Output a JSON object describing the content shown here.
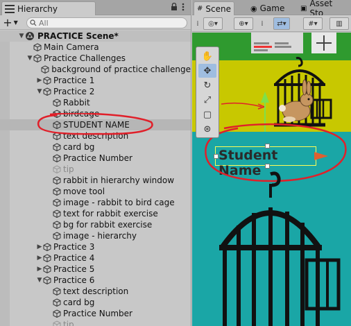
{
  "hierarchy": {
    "tab_label": "Hierarchy",
    "menu_icon": "kebab-icon",
    "lock_icon": "lock-icon",
    "add_label": "+",
    "search_placeholder": "All",
    "scene_name": "PRACTICE Scene*",
    "items": [
      {
        "label": "Main Camera",
        "depth": 1,
        "arrow": "",
        "dim": false
      },
      {
        "label": "Practice Challenges",
        "depth": 1,
        "arrow": "▼",
        "dim": false
      },
      {
        "label": "background of practice challenge",
        "depth": 2,
        "arrow": "",
        "dim": false
      },
      {
        "label": "Practice 1",
        "depth": 2,
        "arrow": "▶",
        "dim": false
      },
      {
        "label": "Practice 2",
        "depth": 2,
        "arrow": "▼",
        "dim": false
      },
      {
        "label": "Rabbit",
        "depth": 3,
        "arrow": "",
        "dim": false
      },
      {
        "label": "birdcage",
        "depth": 3,
        "arrow": "",
        "dim": false
      },
      {
        "label": "STUDENT NAME",
        "depth": 3,
        "arrow": "",
        "dim": false
      },
      {
        "label": "text description",
        "depth": 3,
        "arrow": "",
        "dim": false
      },
      {
        "label": "card bg",
        "depth": 3,
        "arrow": "",
        "dim": false
      },
      {
        "label": "Practice Number",
        "depth": 3,
        "arrow": "",
        "dim": false
      },
      {
        "label": "tip",
        "depth": 3,
        "arrow": "",
        "dim": true
      },
      {
        "label": "rabbit in hierarchy window",
        "depth": 3,
        "arrow": "",
        "dim": false
      },
      {
        "label": "move tool",
        "depth": 3,
        "arrow": "",
        "dim": false
      },
      {
        "label": "image - rabbit to bird cage",
        "depth": 3,
        "arrow": "",
        "dim": false
      },
      {
        "label": "text for rabbit exercise",
        "depth": 3,
        "arrow": "",
        "dim": false
      },
      {
        "label": "bg for rabbit exercise",
        "depth": 3,
        "arrow": "",
        "dim": false
      },
      {
        "label": "image - hierarchy",
        "depth": 3,
        "arrow": "",
        "dim": false
      },
      {
        "label": "Practice 3",
        "depth": 2,
        "arrow": "▶",
        "dim": false
      },
      {
        "label": "Practice 4",
        "depth": 2,
        "arrow": "▶",
        "dim": false
      },
      {
        "label": "Practice 5",
        "depth": 2,
        "arrow": "▶",
        "dim": false
      },
      {
        "label": "Practice 6",
        "depth": 2,
        "arrow": "▼",
        "dim": false
      },
      {
        "label": "text description",
        "depth": 3,
        "arrow": "",
        "dim": false
      },
      {
        "label": "card bg",
        "depth": 3,
        "arrow": "",
        "dim": false
      },
      {
        "label": "Practice Number",
        "depth": 3,
        "arrow": "",
        "dim": false
      },
      {
        "label": "tip",
        "depth": 3,
        "arrow": "",
        "dim": true
      }
    ]
  },
  "scene": {
    "tabs": [
      "Scene",
      "Game",
      "Asset Sto"
    ],
    "active_tab": "Scene",
    "student_name_text": "Student Name"
  },
  "colors": {
    "annotation_red": "#e0202a",
    "yellow_bg": "#c8c800",
    "teal_bg": "#1aa6a6",
    "selection_blue": "#9fbde0"
  }
}
